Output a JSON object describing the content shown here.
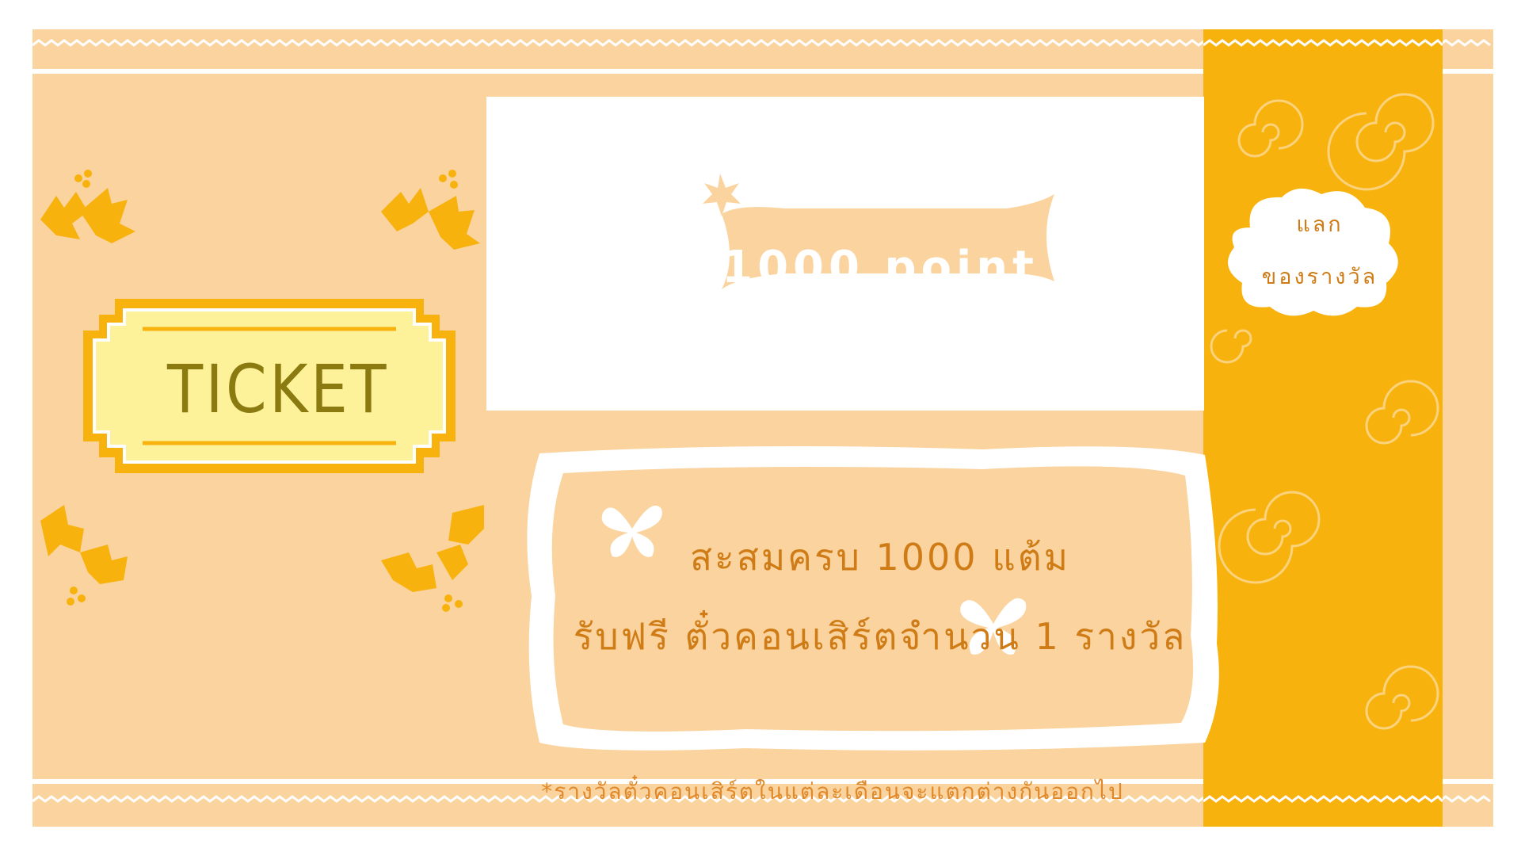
{
  "ticket": {
    "label": "TICKET"
  },
  "points_banner": {
    "label": "1000 point"
  },
  "message": {
    "line1": "สะสมครบ 1000 แต้ม",
    "line2": "รับฟรี ตั๋วคอนเสิร์ตจำนวน 1 รางวัล"
  },
  "footnote": "*รางวัลตั๋วคอนเสิร์ตในแต่ละเดือนจะแตกต่างกันออกไป",
  "redeem_button": {
    "line1": "แลก",
    "line2": "ของรางวัล"
  },
  "colors": {
    "background": "#fbd39e",
    "accent": "#f8b20e",
    "text": "#d07c16",
    "ticket_fill": "#fdf29a"
  }
}
